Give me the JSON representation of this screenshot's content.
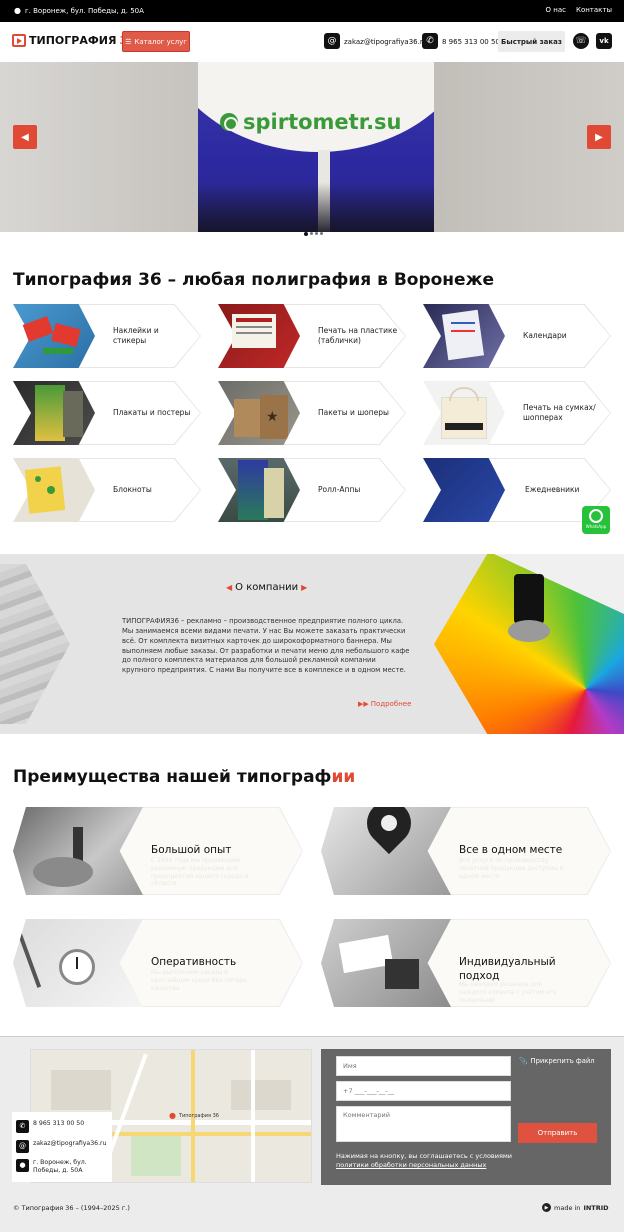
{
  "topbar": {
    "address": "г. Воронеж, бул. Победы, д. 50А",
    "links": [
      "О нас",
      "Контакты"
    ]
  },
  "header": {
    "logo_text": "ТИПОГРАФИЯ",
    "logo_num": "36",
    "catalog_label": "Каталог услуг",
    "email": "zakaz@tipografiya36.ru",
    "phone": "8 965 313 00 50",
    "quick_order_label": "Быстрый заказ"
  },
  "slider": {
    "brand_text": "spirtometr.su",
    "dots": 4,
    "active_dot": 0
  },
  "main_title": "Типография 36 – любая полиграфия в Воронеже",
  "products": [
    {
      "label": "Наклейки и стикеры"
    },
    {
      "label": "Печать на пластике (таблички)"
    },
    {
      "label": "Календари"
    },
    {
      "label": "Плакаты и постеры"
    },
    {
      "label": "Пакеты и шоперы"
    },
    {
      "label": "Печать на сумках/ шопперах"
    },
    {
      "label": "Блокноты"
    },
    {
      "label": "Ролл-Аппы"
    },
    {
      "label": "Ежедневники"
    }
  ],
  "whatsapp_label": "WhatsApp",
  "about": {
    "title": "О компании",
    "text": "ТИПОГРАФИЯ36 – рекламно – производственное предприятие полного цикла. Мы занимаемся всеми видами печати. У нас Вы можете заказать практически всё. От комплекта визитных карточек до широкоформатного баннера. Мы выполняем любые заказы. От разработки и печати меню для небольшого кафе до полного комплекта материалов для большой рекламной компании крупного предприятия. С нами Вы получите все в комплексе и в одном месте.",
    "more_label": "Подробнее"
  },
  "advantages": {
    "title_main": "Преимущества нашей типограф",
    "title_accent": "ии",
    "items": [
      {
        "title": "Большой опыт",
        "sub": "С 1994 года мы производим рекламную продукцию для предприятий нашего города и области"
      },
      {
        "title": "Все в одном месте",
        "sub": "Все услуги по производству печатной продукции доступны в одном месте"
      },
      {
        "title": "Оперативность",
        "sub": "Мы выполняем заказы в кратчайшие сроки без потери качества"
      },
      {
        "title": "Индивидуальный подход",
        "sub": "Мы находим решение для каждого клиента с учётом его пожеланий"
      }
    ]
  },
  "contacts": {
    "phone": "8 965 313 00 50",
    "email": "zakaz@tipografiya36.ru",
    "address": "г. Воронеж, бул. Победы, д. 50А",
    "map_label": "Типография 36"
  },
  "form": {
    "name_placeholder": "Имя",
    "phone_placeholder": "+7 ___-___-__-__",
    "comment_placeholder": "Комментарий",
    "attach_label": "Прикрепить файл",
    "send_label": "Отправить",
    "agree_text": "Нажимая на кнопку, вы соглашаетесь с условиями",
    "agree_link": "политики обработки персональных данных"
  },
  "footer": {
    "copyright": "© Типография 36 – (1994–2025 г.)",
    "made_in_prefix": "made in",
    "made_in_brand": "INTRID"
  },
  "colors": {
    "accent": "#e04a35",
    "whatsapp": "#25c23a",
    "form_bg": "#666666"
  }
}
